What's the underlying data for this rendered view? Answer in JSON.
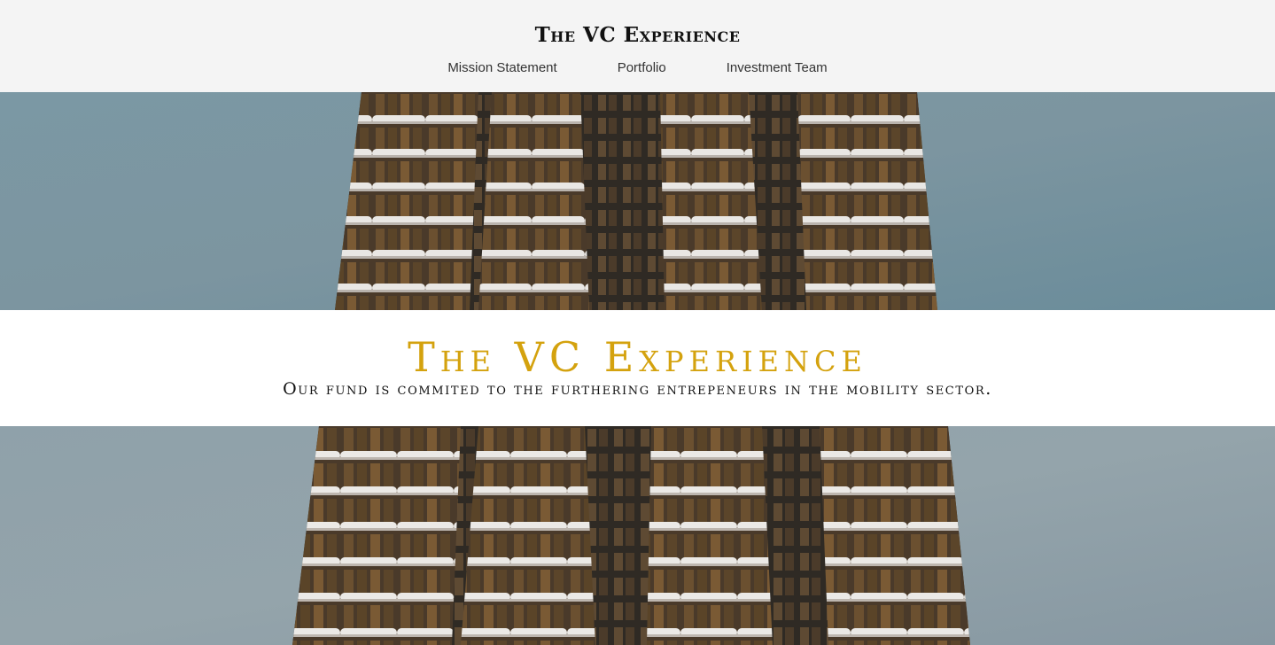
{
  "header": {
    "brand": "The VC Experience",
    "nav": [
      {
        "label": "Mission Statement"
      },
      {
        "label": "Portfolio"
      },
      {
        "label": "Investment Team"
      }
    ]
  },
  "hero": {
    "title": "The VC Experience",
    "subtitle": "Our fund is commited to the furthering entrepeneurs in the mobility sector.",
    "image": "high-rise-building-photo"
  },
  "colors": {
    "header_bg": "#f4f4f4",
    "accent_gold": "#d4a20e",
    "sky": "#7f9aa6",
    "band_bg": "#ffffff"
  }
}
